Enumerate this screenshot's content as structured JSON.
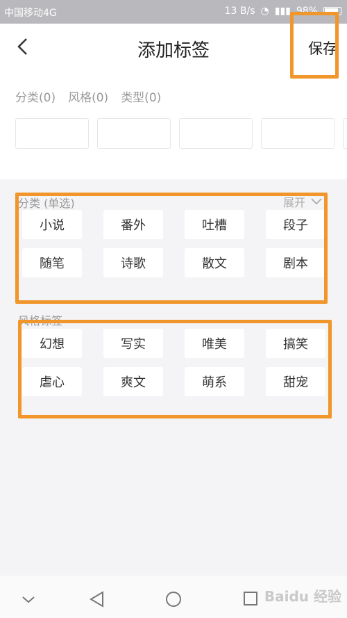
{
  "status_bar": {
    "carrier": "中国移动4G",
    "speed": "13 B/s",
    "battery": "98%"
  },
  "header": {
    "title": "添加标签",
    "save_label": "保存"
  },
  "counts": {
    "category": "分类(0)",
    "style": "风格(0)",
    "type": "类型(0)"
  },
  "category_section": {
    "title": "分类 (单选)",
    "expand_label": "展开",
    "tags": [
      "小说",
      "番外",
      "吐槽",
      "段子",
      "随笔",
      "诗歌",
      "散文",
      "剧本"
    ]
  },
  "style_section": {
    "title": "风格标签",
    "tags": [
      "幻想",
      "写实",
      "唯美",
      "搞笑",
      "虐心",
      "爽文",
      "萌系",
      "甜宠"
    ]
  },
  "watermark": "Baidu 经验",
  "colors": {
    "highlight": "#f0962a",
    "background": "#f4f4f6"
  }
}
